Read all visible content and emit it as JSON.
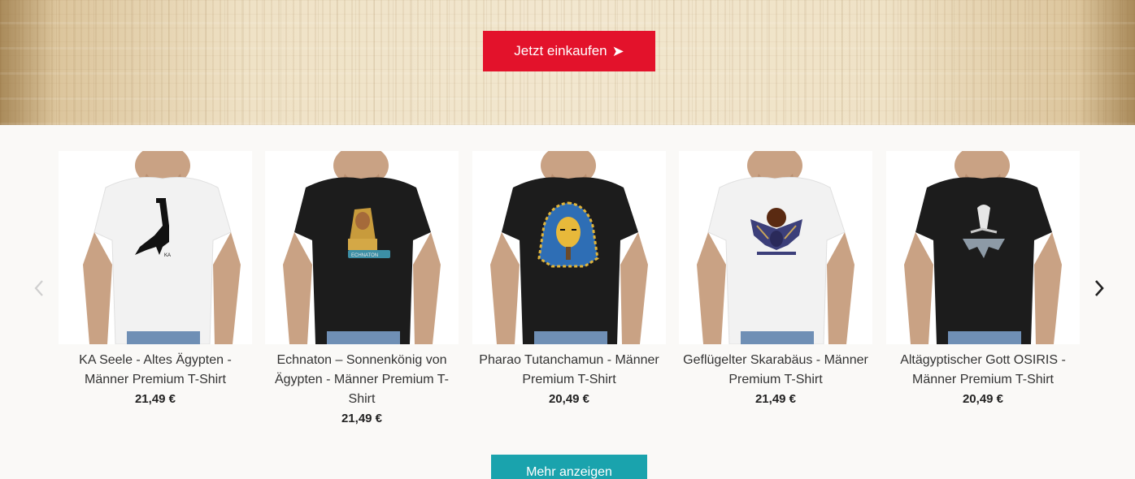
{
  "hero": {
    "shop_button_label": "Jetzt einkaufen",
    "shop_button_arrow": "➤",
    "button_color": "#e3122b"
  },
  "carousel": {
    "prev_icon": "chevron-left-icon",
    "next_icon": "chevron-right-icon",
    "products": [
      {
        "title": "KA Seele - Altes Ägypten - Männer Premium T-Shirt",
        "price": "21,49 €",
        "shirt_color": "#f2f2f2",
        "motif": "ka-bird"
      },
      {
        "title": "Echnaton – Sonnenkönig von Ägypten - Männer Premium T-Shirt",
        "price": "21,49 €",
        "shirt_color": "#1c1c1c",
        "motif": "echnaton"
      },
      {
        "title": "Pharao Tutanchamun - Männer Premium T-Shirt",
        "price": "20,49 €",
        "shirt_color": "#1c1c1c",
        "motif": "tutanchamun-mask"
      },
      {
        "title": "Geflügelter Skarabäus - Männer Premium T-Shirt",
        "price": "21,49 €",
        "shirt_color": "#f2f2f2",
        "motif": "winged-scarab"
      },
      {
        "title": "Altägyptischer Gott OSIRIS - Männer Premium T-Shirt",
        "price": "20,49 €",
        "shirt_color": "#1c1c1c",
        "motif": "osiris"
      }
    ]
  },
  "more_button_label": "Mehr anzeigen",
  "more_button_color": "#1aa3ad"
}
